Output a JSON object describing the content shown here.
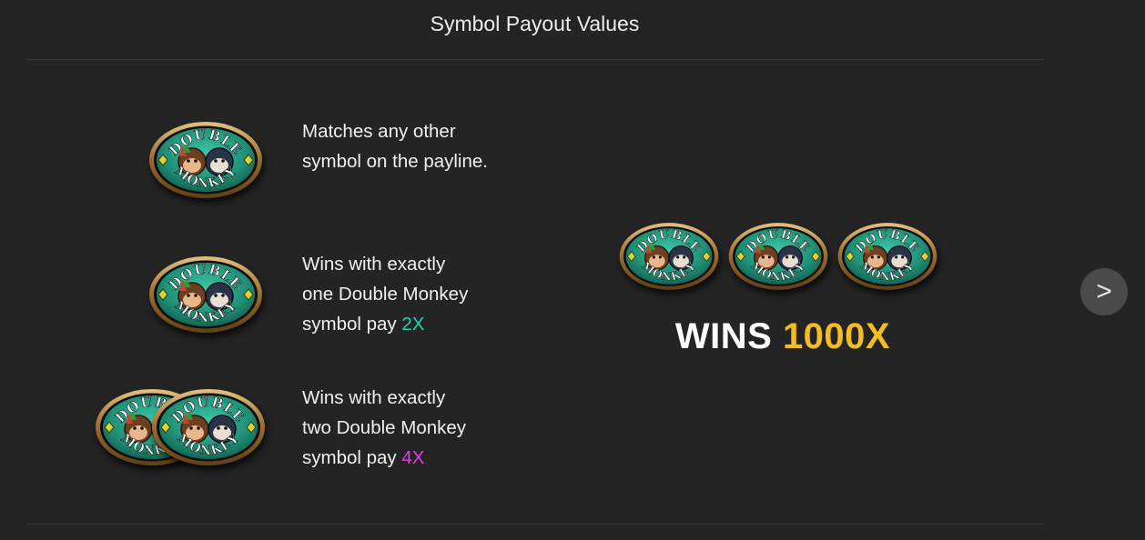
{
  "header": {
    "title": "Symbol Payout Values"
  },
  "token": {
    "text_top": "DOUBLE",
    "text_bottom": "MONKEY"
  },
  "rows": [
    {
      "lines": [
        "Matches any other",
        "symbol on the payline."
      ]
    },
    {
      "lines": [
        "Wins with exactly",
        "one Double Monkey",
        "symbol pay "
      ],
      "multiplier": "2X"
    },
    {
      "lines": [
        "Wins with exactly",
        "two Double Monkey",
        "symbol pay "
      ],
      "multiplier": "4X"
    }
  ],
  "combo": {
    "label": "WINS",
    "multiplier": "1000X"
  },
  "nav": {
    "next_icon": "chevron-right-icon",
    "next_glyph": ">"
  },
  "colors": {
    "background": "#242424",
    "token_green": "#2aa38a",
    "token_rim": "#b4873f",
    "mult_2x": "#1fd3b4",
    "mult_4x": "#e43be6",
    "mult_1000x": "#f5bd1f"
  }
}
